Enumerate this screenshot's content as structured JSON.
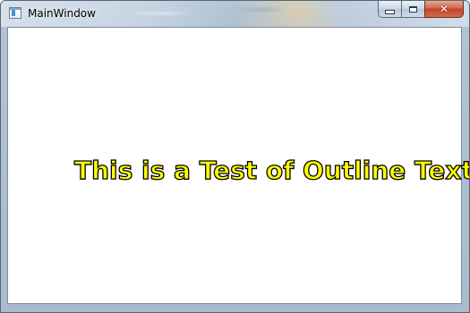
{
  "window": {
    "title": "MainWindow",
    "controls": {
      "minimize": "",
      "maximize": "",
      "close": "✕"
    }
  },
  "content": {
    "outline_text": "This is a Test of Outline Text",
    "fill_color": "#ffff00",
    "stroke_color": "#000000"
  }
}
